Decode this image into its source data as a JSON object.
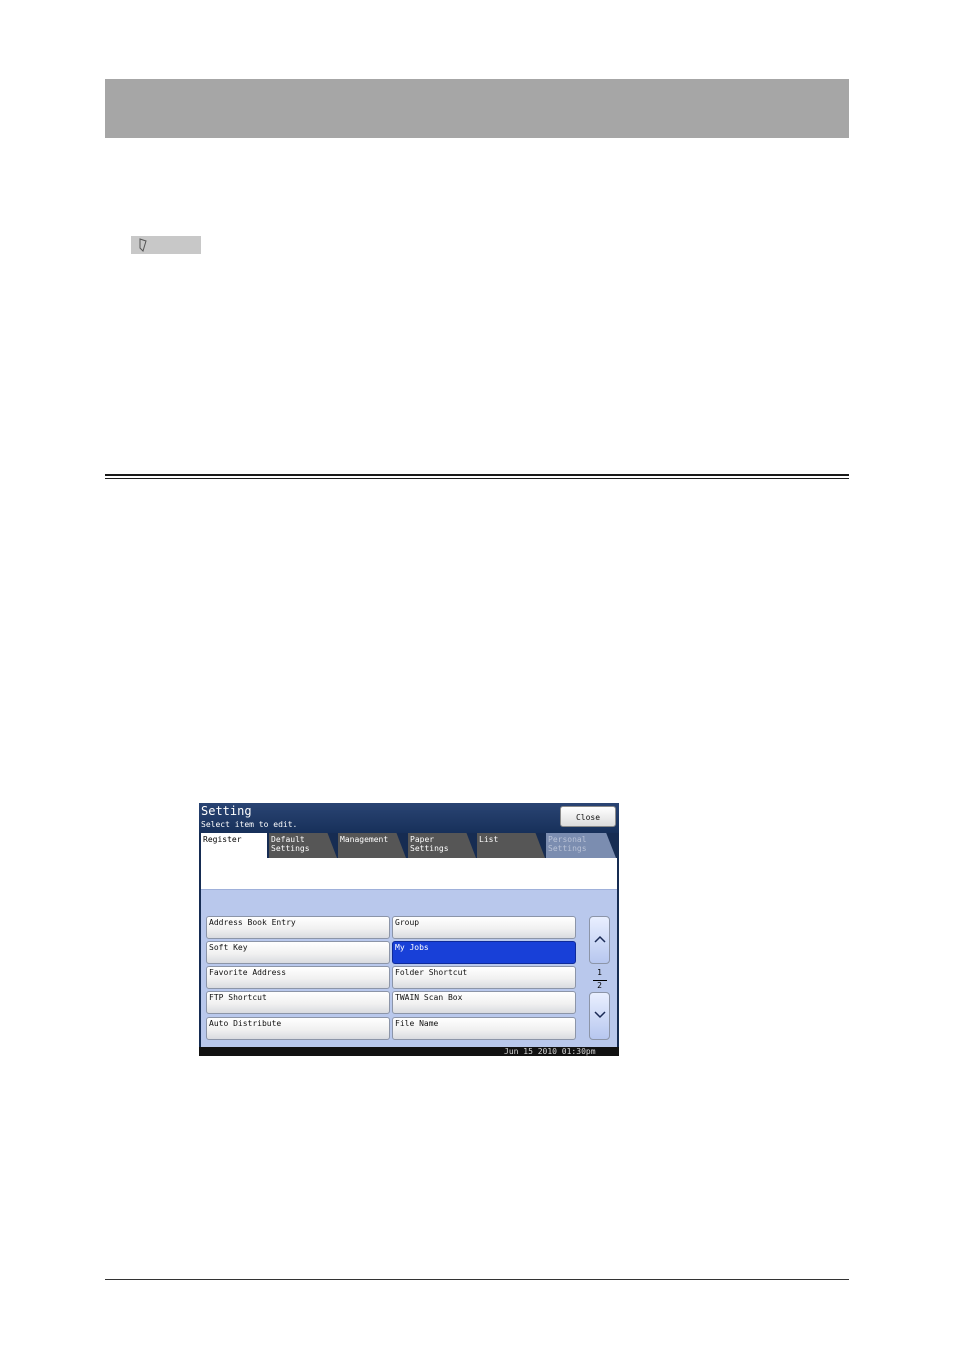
{
  "screen": {
    "title": "Setting",
    "subtitle": "Select item to edit.",
    "close_label": "Close",
    "tabs": [
      {
        "label": "Register"
      },
      {
        "label": "Default\nSettings"
      },
      {
        "label": "Management"
      },
      {
        "label": "Paper\nSettings"
      },
      {
        "label": "List"
      },
      {
        "label": "Personal\nSettings"
      }
    ],
    "items_left": [
      "Address Book Entry",
      "Soft Key",
      "Favorite Address",
      "FTP Shortcut",
      "Auto Distribute"
    ],
    "items_right": [
      "Group",
      "My Jobs",
      "Folder Shortcut",
      "TWAIN Scan Box",
      "File Name"
    ],
    "page": {
      "current": "1",
      "total": "2"
    },
    "datetime": "Jun 15 2010 01:30pm",
    "colors": {
      "selected": "#1840d8",
      "frame": "#162c52",
      "panel": "#b9c8ec"
    }
  }
}
